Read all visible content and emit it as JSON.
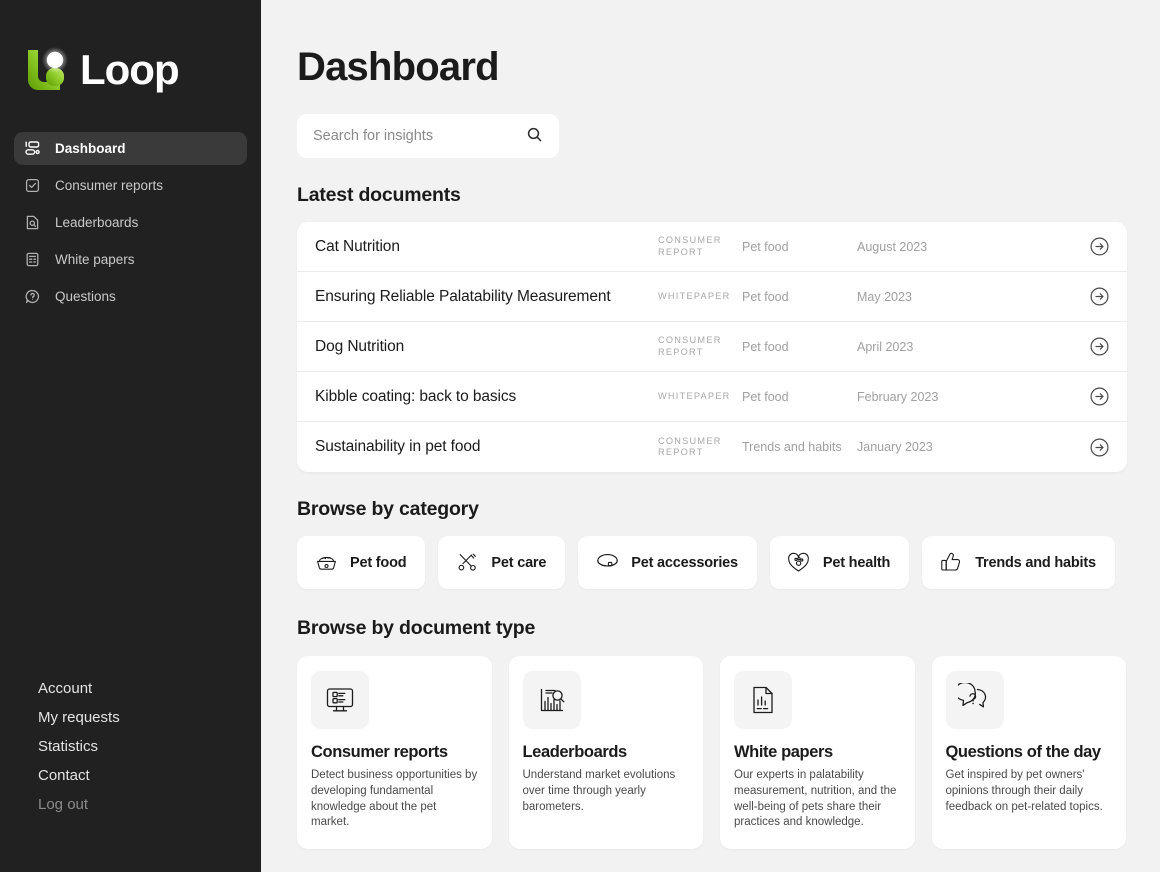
{
  "brand": {
    "name": "Loop",
    "logo_icon": "loop-logo",
    "accent": "#8fce2b",
    "sidebar_bg": "#212121"
  },
  "sidebar": {
    "nav": [
      {
        "label": "Dashboard",
        "icon": "dashboard-icon",
        "active": true
      },
      {
        "label": "Consumer reports",
        "icon": "checkbox-document-icon",
        "active": false
      },
      {
        "label": "Leaderboards",
        "icon": "document-search-icon",
        "active": false
      },
      {
        "label": "White papers",
        "icon": "document-list-icon",
        "active": false
      },
      {
        "label": "Questions",
        "icon": "question-bubble-icon",
        "active": false
      }
    ],
    "bottom_links": [
      {
        "label": "Account",
        "muted": false
      },
      {
        "label": "My requests",
        "muted": false
      },
      {
        "label": "Statistics",
        "muted": false
      },
      {
        "label": "Contact",
        "muted": false
      },
      {
        "label": "Log out",
        "muted": true
      }
    ]
  },
  "header": {
    "title": "Dashboard"
  },
  "search": {
    "placeholder": "Search for insights",
    "value": "",
    "icon": "search-icon"
  },
  "latest": {
    "title": "Latest documents",
    "rows": [
      {
        "title": "Cat Nutrition",
        "type": "CONSUMER REPORT",
        "category": "Pet food",
        "date": "August 2023"
      },
      {
        "title": "Ensuring Reliable Palatability Measurement",
        "type": "WHITEPAPER",
        "category": "Pet food",
        "date": "May 2023"
      },
      {
        "title": "Dog Nutrition",
        "type": "CONSUMER REPORT",
        "category": "Pet food",
        "date": "April 2023"
      },
      {
        "title": "Kibble coating: back to basics",
        "type": "WHITEPAPER",
        "category": "Pet food",
        "date": "February 2023"
      },
      {
        "title": "Sustainability in pet food",
        "type": "CONSUMER REPORT",
        "category": "Trends and habits",
        "date": "January 2023"
      }
    ]
  },
  "categories": {
    "title": "Browse by category",
    "items": [
      {
        "label": "Pet food",
        "icon": "pet-bowl-icon"
      },
      {
        "label": "Pet care",
        "icon": "scissors-comb-icon"
      },
      {
        "label": "Pet accessories",
        "icon": "collar-icon"
      },
      {
        "label": "Pet health",
        "icon": "heart-paw-icon"
      },
      {
        "label": "Trends and habits",
        "icon": "thumbs-up-icon"
      }
    ]
  },
  "doc_types": {
    "title": "Browse by document type",
    "items": [
      {
        "title": "Consumer reports",
        "icon": "monitor-checklist-icon",
        "desc": "Detect business opportunities by developing fundamental knowledge about the pet market."
      },
      {
        "title": "Leaderboards",
        "icon": "bar-chart-search-icon",
        "desc": "Understand market evolutions over time through yearly barometers."
      },
      {
        "title": "White papers",
        "icon": "document-chart-icon",
        "desc": "Our experts in palatability measurement, nutrition, and the well-being of pets share their practices and knowledge."
      },
      {
        "title": "Questions of the day",
        "icon": "question-bubbles-icon",
        "desc": "Get inspired by pet owners' opinions through their daily feedback on pet-related topics."
      }
    ]
  }
}
